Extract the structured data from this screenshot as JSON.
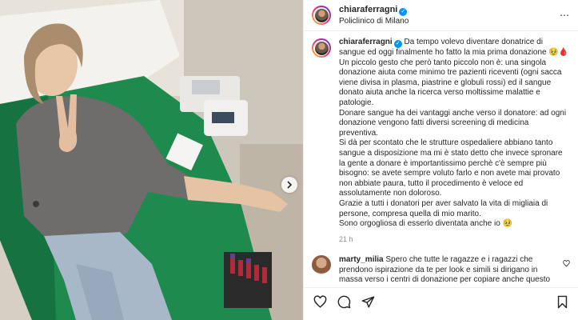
{
  "post": {
    "author": {
      "username": "chiaraferragni",
      "location": "Policlinico di Milano"
    },
    "more_icon": "⋯",
    "caption": {
      "username": "chiaraferragni",
      "paragraphs": [
        "Da tempo volevo diventare donatrice di sangue ed oggi finalmente ho fatto la mia prima donazione 🥹🩸",
        "Un piccolo gesto che però tanto piccolo non è: una singola donazione aiuta come minimo tre pazienti riceventi (ogni sacca viene divisa in plasma, piastrine e globuli rossi) ed il sangue donato aiuta anche la ricerca verso moltissime malattie e patologie.",
        "Donare sangue ha dei vantaggi anche verso il donatore: ad ogni donazione vengono fatti diversi screening di medicina preventiva.",
        "Si dà per scontato che le strutture ospedaliere abbiano tanto sangue a disposizione ma mi è stato detto che invece spronare la gente a donare è importantissimo perchè c'è sempre più bisogno: se avete sempre voluto farlo e non avete mai provato non abbiate paura, tutto il procedimento è veloce ed assolutamente non doloroso.",
        "Grazie a tutti i donatori per aver salvato la vita di migliaia di persone, compresa quella di mio marito.",
        "Sono orgogliosa di esserlo diventata anche io 🥹"
      ],
      "time": "21 h"
    },
    "comment": {
      "username": "marty_milia",
      "text": "Spero che tutte le ragazze e i ragazzi che prendono ispirazione da te per look e simili si dirigano in massa verso i centri di donazione per copiare anche questo"
    },
    "icons": {
      "verified": "verified-badge-icon",
      "heart": "heart-icon",
      "comment": "comment-icon",
      "share": "share-icon",
      "save": "bookmark-icon",
      "next": "chevron-right-icon"
    },
    "colors": {
      "verified": "#0095f6",
      "text": "#262626",
      "muted": "#8e8e8e"
    }
  }
}
